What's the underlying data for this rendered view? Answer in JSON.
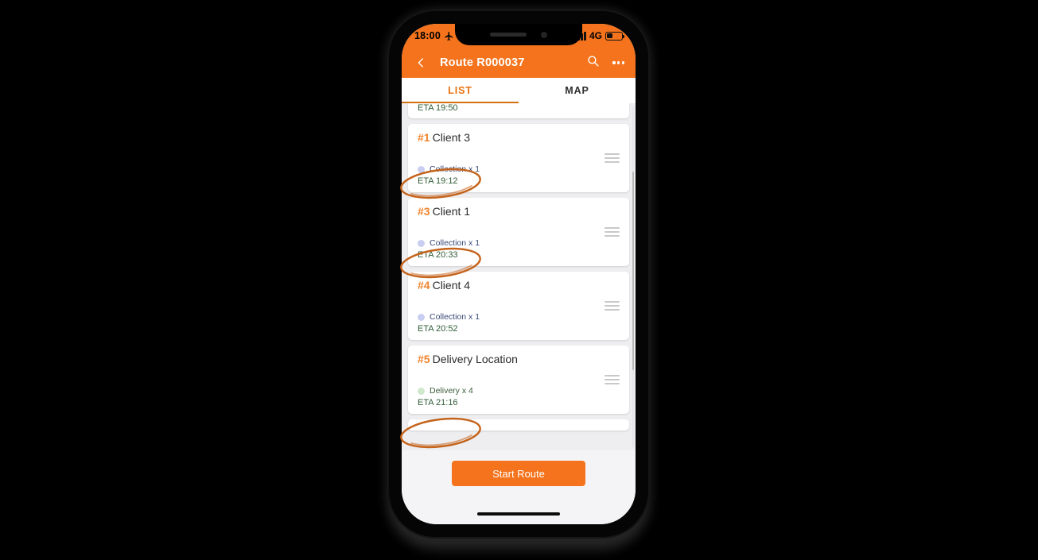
{
  "theme": {
    "accent": "#f4731c",
    "accent_text": "#e8720f",
    "annotation": "#c4631b"
  },
  "status_bar": {
    "time": "18:00",
    "airplane_icon": "airplane-icon",
    "network": "4G",
    "signal_icon": "signal-bars-icon",
    "battery_icon": "battery-icon"
  },
  "app_bar": {
    "back_icon": "back-chevron-icon",
    "title": "Route R000037",
    "search_icon": "search-icon",
    "overflow_icon": "more-options-icon"
  },
  "tabs": [
    {
      "label": "LIST",
      "active": true
    },
    {
      "label": "MAP",
      "active": false
    }
  ],
  "list": {
    "top_partial": {
      "eta": "ETA 19:50"
    },
    "items": [
      {
        "seq": "#1",
        "name": "Client 3",
        "job_type": "Collection x 1",
        "job_kind": "collection",
        "eta": "ETA 19:12",
        "annotated": true,
        "drag_handle_icon": "drag-handle-icon"
      },
      {
        "seq": "#3",
        "name": "Client 1",
        "job_type": "Collection x 1",
        "job_kind": "collection",
        "eta": "ETA 20:33",
        "annotated": true,
        "drag_handle_icon": "drag-handle-icon"
      },
      {
        "seq": "#4",
        "name": "Client 4",
        "job_type": "Collection x 1",
        "job_kind": "collection",
        "eta": "ETA 20:52",
        "annotated": false,
        "drag_handle_icon": "drag-handle-icon"
      },
      {
        "seq": "#5",
        "name": "Delivery Location",
        "job_type": "Delivery x 4",
        "job_kind": "delivery",
        "eta": "ETA 21:16",
        "annotated": true,
        "drag_handle_icon": "drag-handle-icon"
      }
    ]
  },
  "bottom": {
    "start_label": "Start Route"
  }
}
